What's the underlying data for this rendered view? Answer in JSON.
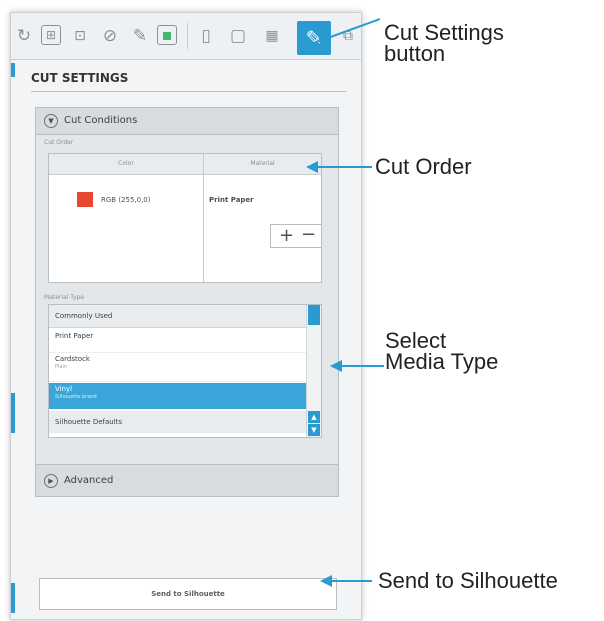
{
  "toolbar": {
    "icons": [
      "refresh-icon",
      "page-setup-icon",
      "registration-marks-icon",
      "offset-icon",
      "trace-icon",
      "fill-icon",
      "send-page-icon",
      "library-icon",
      "grid-icon",
      "cut-settings-icon",
      "expand-icon"
    ]
  },
  "panel": {
    "title": "CUT SETTINGS",
    "cut_conditions_label": "Cut Conditions",
    "cut_order_label": "Cut Order",
    "table": {
      "col_color": "Color",
      "col_material": "Material",
      "color_value": "RGB (255,0,0)",
      "material_value": "Print Paper",
      "swatch_color": "#e8492e"
    },
    "material_type_label": "Material Type",
    "media": {
      "header": "Commonly Used",
      "items": [
        {
          "label": "Print Paper",
          "sub": ""
        },
        {
          "label": "Cardstock",
          "sub": "Plain"
        }
      ],
      "selected": {
        "label": "Vinyl",
        "sub": "Silhouette brand"
      },
      "defaults": "Silhouette Defaults",
      "plus": "+",
      "minus": "−"
    },
    "advanced_label": "Advanced",
    "send_button": "Send to Silhouette"
  },
  "callouts": {
    "cut_settings": "Cut Settings\nbutton",
    "cut_order": "Cut Order",
    "media_type": "Select\nMedia Type",
    "send": "Send to Silhouette"
  },
  "colors": {
    "accent": "#2a9bd0",
    "selected_row": "#3aa5d8",
    "swatch": "#e8492e"
  }
}
